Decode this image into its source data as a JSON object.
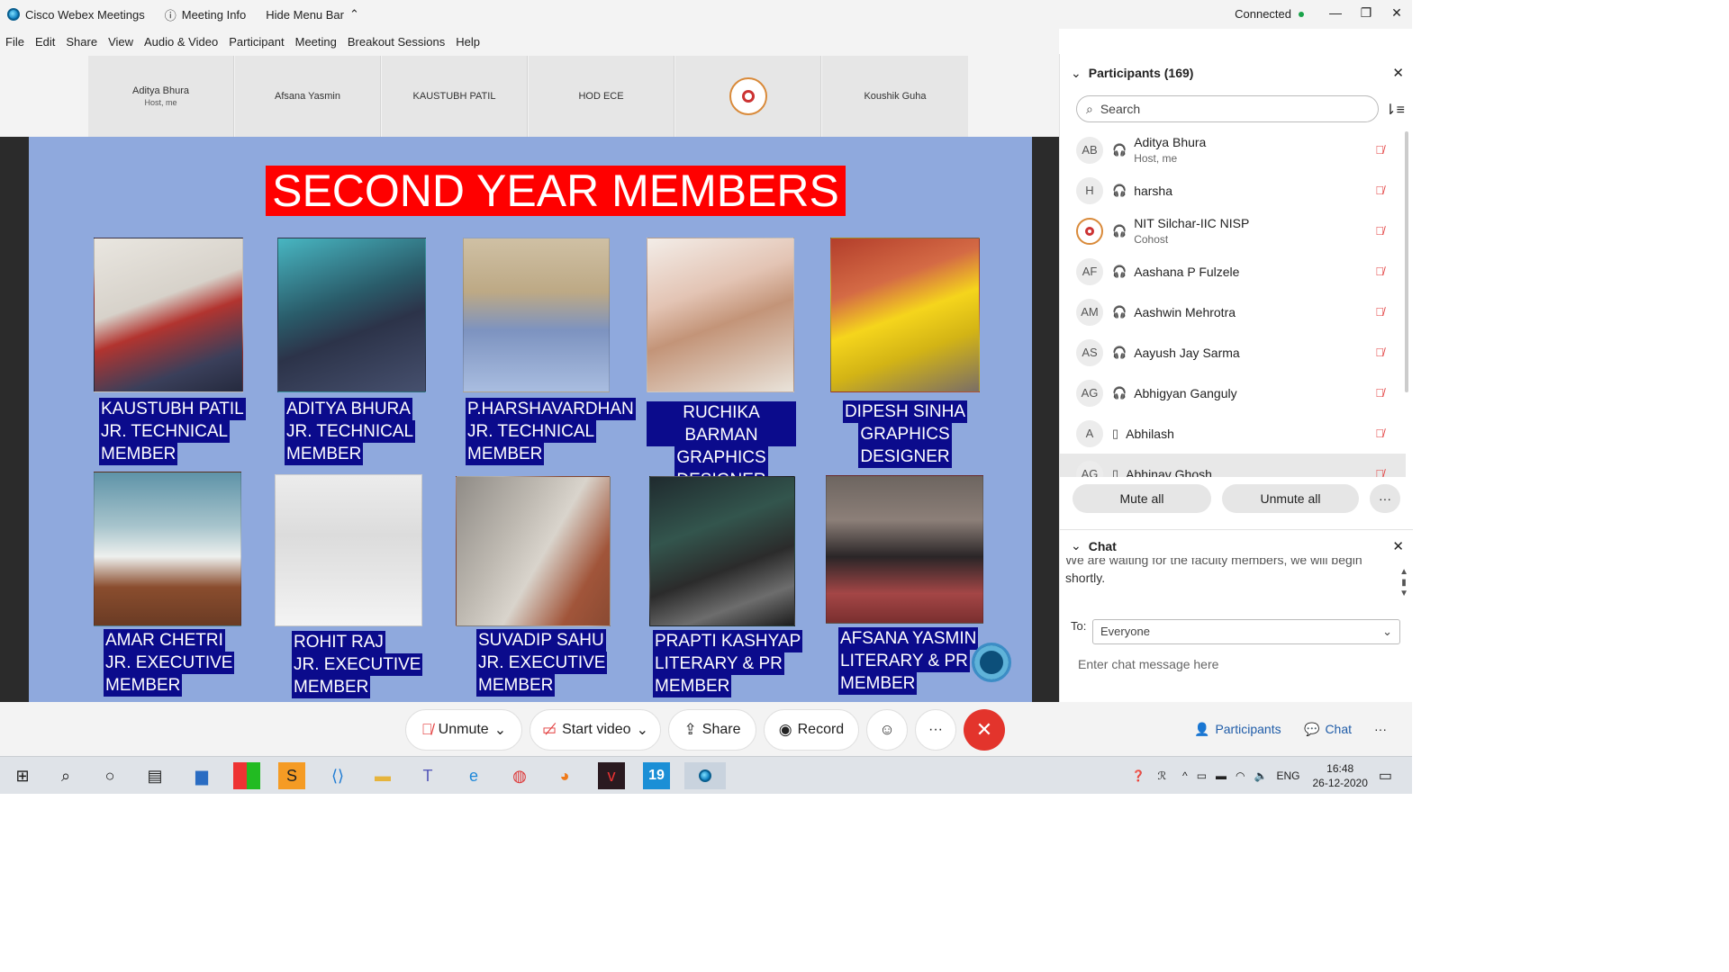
{
  "titlebar": {
    "app_title": "Cisco Webex Meetings",
    "meeting_info": "Meeting Info",
    "hide_menu": "Hide Menu Bar",
    "status": "Connected"
  },
  "menu": [
    "File",
    "Edit",
    "Share",
    "View",
    "Audio & Video",
    "Participant",
    "Meeting",
    "Breakout Sessions",
    "Help"
  ],
  "thumbnails": [
    {
      "name": "Aditya Bhura",
      "sub": "Host, me"
    },
    {
      "name": "Afsana Yasmin",
      "sub": ""
    },
    {
      "name": "KAUSTUBH PATIL",
      "sub": ""
    },
    {
      "name": "HOD ECE",
      "sub": ""
    },
    {
      "name": "",
      "sub": ""
    },
    {
      "name": "Koushik Guha",
      "sub": ""
    }
  ],
  "slide": {
    "title": "SECOND YEAR MEMBERS",
    "members": [
      {
        "l1": "KAUSTUBH PATIL",
        "l2": "JR. TECHNICAL",
        "l3": "MEMBER"
      },
      {
        "l1": "ADITYA BHURA",
        "l2": "JR. TECHNICAL",
        "l3": "MEMBER"
      },
      {
        "l1": "P.HARSHAVARDHAN",
        "l2": "JR. TECHNICAL",
        "l3": "MEMBER"
      },
      {
        "l1": "RUCHIKA BARMAN",
        "l2": "GRAPHICS",
        "l3": "DESIGNER"
      },
      {
        "l1": "DIPESH SINHA",
        "l2": "GRAPHICS",
        "l3": "DESIGNER"
      },
      {
        "l1": "AMAR CHETRI",
        "l2": "JR. EXECUTIVE",
        "l3": "MEMBER"
      },
      {
        "l1": "ROHIT RAJ",
        "l2": "JR. EXECUTIVE",
        "l3": "MEMBER"
      },
      {
        "l1": "SUVADIP SAHU",
        "l2": "JR. EXECUTIVE",
        "l3": "MEMBER"
      },
      {
        "l1": "PRAPTI  KASHYAP",
        "l2": "LITERARY & PR",
        "l3": "MEMBER"
      },
      {
        "l1": "AFSANA YASMIN",
        "l2": "LITERARY & PR",
        "l3": "MEMBER"
      }
    ]
  },
  "participants": {
    "header": "Participants (169)",
    "search_placeholder": "Search",
    "list": [
      {
        "initials": "AB",
        "name": "Aditya Bhura",
        "role": "Host, me"
      },
      {
        "initials": "H",
        "name": "harsha",
        "role": ""
      },
      {
        "initials": "",
        "name": "NIT Silchar-IIC NISP",
        "role": "Cohost"
      },
      {
        "initials": "AF",
        "name": "Aashana P Fulzele",
        "role": ""
      },
      {
        "initials": "AM",
        "name": "Aashwin Mehrotra",
        "role": ""
      },
      {
        "initials": "AS",
        "name": "Aayush Jay Sarma",
        "role": ""
      },
      {
        "initials": "AG",
        "name": "Abhigyan Ganguly",
        "role": ""
      },
      {
        "initials": "A",
        "name": "Abhilash",
        "role": ""
      },
      {
        "initials": "AG",
        "name": "Abhinav Ghosh",
        "role": ""
      }
    ],
    "mute_all": "Mute all",
    "unmute_all": "Unmute all",
    "more": "···"
  },
  "chat": {
    "header": "Chat",
    "msg_cut": "We are waiting for the faculty members, we will begin",
    "msg_end": "shortly.",
    "to_label": "To:",
    "to_value": "Everyone",
    "input_placeholder": "Enter chat message here"
  },
  "controls": {
    "unmute": "Unmute",
    "start_video": "Start video",
    "share": "Share",
    "record": "Record",
    "more": "···",
    "participants_tab": "Participants",
    "chat_tab": "Chat",
    "more_tab": "···"
  },
  "taskbar": {
    "lang": "ENG",
    "time": "16:48",
    "date": "26-12-2020",
    "badge": "19"
  }
}
